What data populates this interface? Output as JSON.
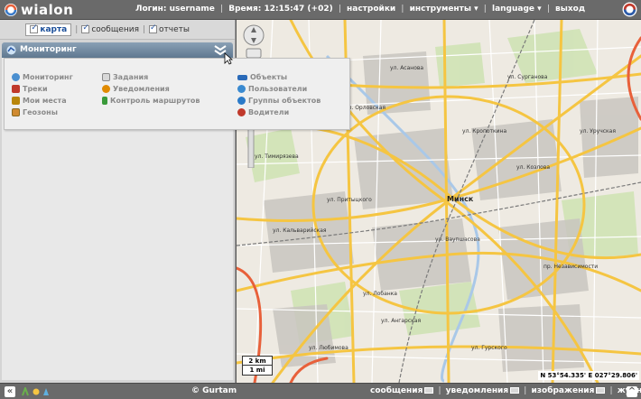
{
  "header": {
    "logo_text": "wialon",
    "login_label": "Логин:",
    "username": "username",
    "time_label": "Время:",
    "time_value": "12:15:47 (+02)",
    "settings": "настройки",
    "tools": "инструменты ▾",
    "language": "language ▾",
    "exit": "выход"
  },
  "tabs": [
    {
      "label": "карта",
      "active": true
    },
    {
      "label": "сообщения",
      "active": false
    },
    {
      "label": "отчеты",
      "active": false
    }
  ],
  "panel": {
    "title": "Мониторинг"
  },
  "menu": {
    "col1": [
      {
        "label": "Мониторинг",
        "icon": "monitoring-icon",
        "color": "#4a8fd0"
      },
      {
        "label": "Треки",
        "icon": "tracks-icon",
        "color": "#c0392b"
      },
      {
        "label": "Мои места",
        "icon": "places-icon",
        "color": "#b8860b"
      },
      {
        "label": "Геозоны",
        "icon": "geofences-icon",
        "color": "#d08a30"
      }
    ],
    "col2": [
      {
        "label": "Задания",
        "icon": "tasks-icon",
        "color": "#999999"
      },
      {
        "label": "Уведомления",
        "icon": "notifications-icon",
        "color": "#e08a00"
      },
      {
        "label": "Контроль маршрутов",
        "icon": "routes-icon",
        "color": "#3a9a3a"
      }
    ],
    "col3": [
      {
        "label": "Объекты",
        "icon": "units-icon",
        "color": "#2a6ab8"
      },
      {
        "label": "Пользователи",
        "icon": "users-icon",
        "color": "#3a8ad0"
      },
      {
        "label": "Группы объектов",
        "icon": "unit-groups-icon",
        "color": "#2a7ac8"
      },
      {
        "label": "Водители",
        "icon": "drivers-icon",
        "color": "#c0392b"
      }
    ]
  },
  "map": {
    "city_label": "Минск",
    "scale_km": "2 km",
    "scale_mi": "1 mi",
    "coordinates": "N 53°54.335' E 027°29.806'",
    "streets": [
      "ул. Орловская",
      "ул. Кропоткина",
      "ул. Тимирязева",
      "ул. Притыцкого",
      "ул. Лобанка",
      "ул. Кальварийская",
      "ул. Сурганова",
      "ул. Козлова",
      "ул. Ваупшасова",
      "ул. Ангарская",
      "ул. Любимова",
      "пр. Независимости",
      "ул. Уручская",
      "ул. Гурского",
      "ул. Асанова"
    ]
  },
  "footer": {
    "copyright": "© Gurtam",
    "messages": "сообщения",
    "notifications": "уведомления",
    "images": "изображения",
    "log": "журнал"
  },
  "colors": {
    "topbar": "#6a6a6a",
    "panel_header": "#5f7890",
    "map_background": "#eeeae2",
    "road_major": "#f5c542",
    "road_trunk": "#e8603a"
  }
}
